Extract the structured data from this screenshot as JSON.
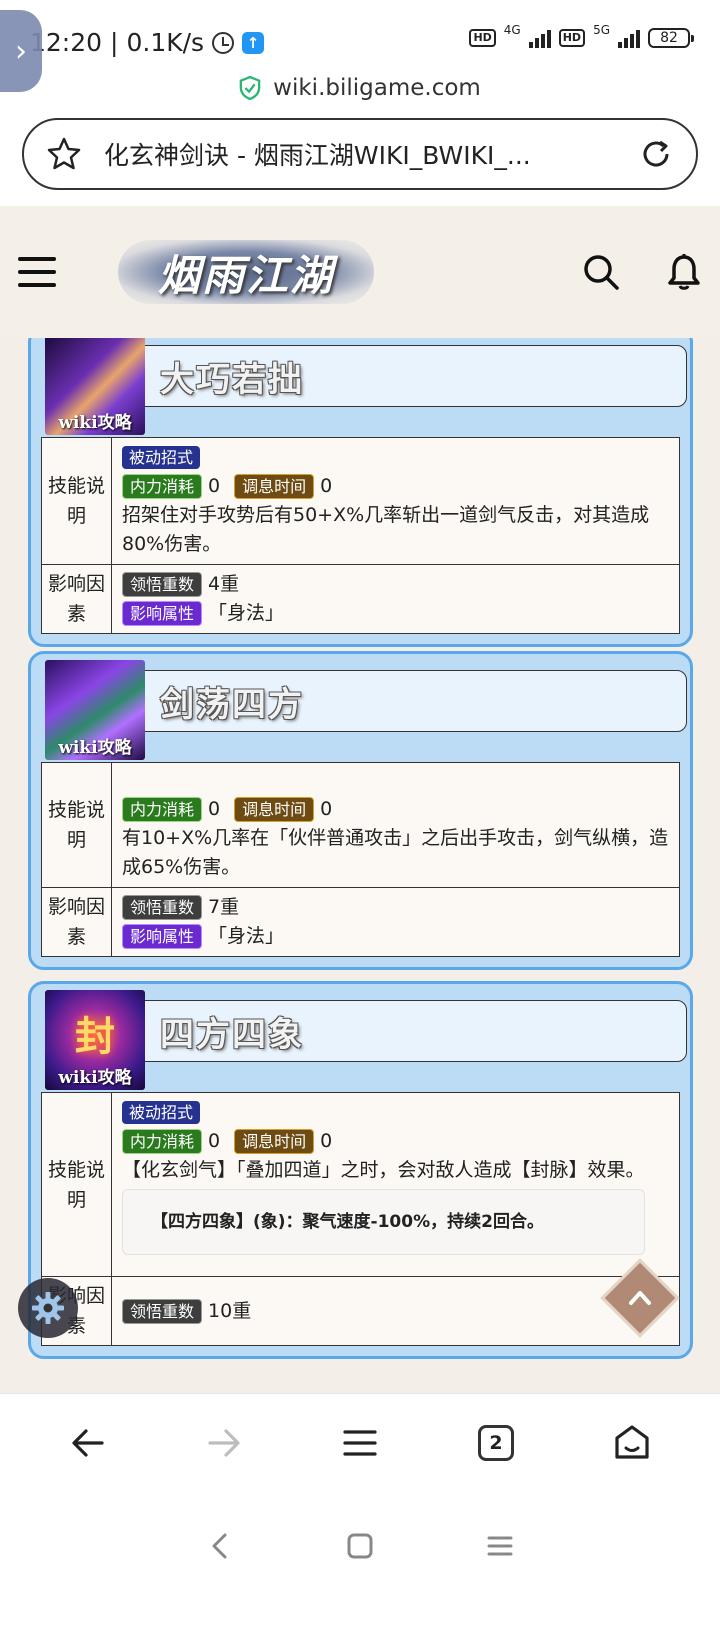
{
  "status_bar": {
    "time": "12:20",
    "speed": "0.1K/s",
    "net1": "4G",
    "net2": "5G",
    "hd": "HD",
    "battery": "82"
  },
  "url": {
    "domain": "wiki.biligame.com",
    "title": "化玄神剑诀 - 烟雨江湖WIKI_BWIKI_..."
  },
  "site": {
    "logo_text": "烟雨江湖"
  },
  "watermark": "wiki攻略",
  "skills": [
    {
      "name": "大巧若拙",
      "desc_label": "技能说明",
      "factor_label": "影响因素",
      "passive_tag": "被动招式",
      "mp_label": "内力消耗",
      "mp_value": "0",
      "cd_label": "调息时间",
      "cd_value": "0",
      "description": "招架住对手攻势后有50+X%几率斩出一道剑气反击，对其造成80%伤害。",
      "comp_label": "领悟重数",
      "comp_value": "4重",
      "attr_label": "影响属性",
      "attr_value": "「身法」"
    },
    {
      "name": "剑荡四方",
      "desc_label": "技能说明",
      "factor_label": "影响因素",
      "mp_label": "内力消耗",
      "mp_value": "0",
      "cd_label": "调息时间",
      "cd_value": "0",
      "description": "有10+X%几率在「伙伴普通攻击」之后出手攻击，剑气纵横，造成65%伤害。",
      "comp_label": "领悟重数",
      "comp_value": "7重",
      "attr_label": "影响属性",
      "attr_value": "「身法」"
    },
    {
      "name": "四方四象",
      "icon_glyph": "封",
      "desc_label": "技能说明",
      "factor_label": "影响因素",
      "passive_tag": "被动招式",
      "mp_label": "内力消耗",
      "mp_value": "0",
      "cd_label": "调息时间",
      "cd_value": "0",
      "description": "【化玄剑气】「叠加四道」之时，会对敌人造成【封脉】效果。",
      "effect": "【四方四象】(象)：聚气速度-100%，持续2回合。",
      "comp_label": "领悟重数",
      "comp_value": "10重"
    }
  ],
  "browser_nav": {
    "tab_count": "2"
  },
  "colors": {
    "card_bg": "#bcdcf6",
    "card_border": "#5aa8ea",
    "tag_blue": "#25328f",
    "tag_green": "#2a7a1e",
    "tag_brown": "#6d4b12",
    "tag_gray": "#3e3e3e",
    "tag_purple": "#6a2ad0"
  }
}
